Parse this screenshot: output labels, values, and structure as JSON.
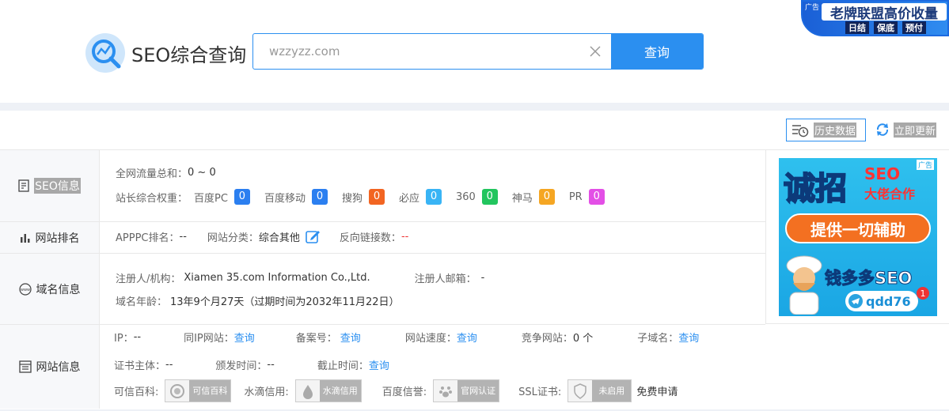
{
  "header": {
    "logo_title": "SEO综合查询",
    "search_value": "wzzyzz.com",
    "search_button": "查询"
  },
  "top_ad": {
    "tag": "广告",
    "title": "老牌联盟高价收量",
    "sub1": "日结",
    "sub2": "保底",
    "sub3": "预付"
  },
  "toolbar": {
    "history_label": "历史数据",
    "update_label": "立即更新"
  },
  "seo_info": {
    "label": "SEO信息",
    "traffic_key": "全网流量总和：",
    "traffic_value": "0 ~ 0",
    "weight_key": "站长综合权重：",
    "weights": [
      {
        "name": "百度PC",
        "value": "0",
        "color": "#2b7ff0"
      },
      {
        "name": "百度移动",
        "value": "0",
        "color": "#2b7ff0"
      },
      {
        "name": "搜狗",
        "value": "0",
        "color": "#f26522"
      },
      {
        "name": "必应",
        "value": "0",
        "color": "#39b4f5"
      },
      {
        "name": "360",
        "value": "0",
        "color": "#22c55e"
      },
      {
        "name": "神马",
        "value": "0",
        "color": "#f5a623"
      },
      {
        "name": "PR",
        "value": "0",
        "color": "#e34fe6"
      }
    ]
  },
  "rank_info": {
    "label": "网站排名",
    "apppc_key": "APPPC排名：",
    "apppc_value": "--",
    "category_key": "网站分类：",
    "category_value": "综合其他",
    "backlink_key": "反向链接数：",
    "backlink_value": "--"
  },
  "domain_info": {
    "label": "域名信息",
    "registrant_key": "注册人/机构：",
    "registrant_value": "Xiamen 35.com Information Co.,Ltd.",
    "email_key": "注册人邮箱：",
    "email_value": "-",
    "age_key": "域名年龄：",
    "age_value": "13年9个月27天（过期时间为2032年11月22日）"
  },
  "site_info": {
    "label": "网站信息",
    "ip_key": "IP：",
    "ip_value": "--",
    "same_ip_key": "同IP网站：",
    "same_ip_value": "查询",
    "icp_key": "备案号：",
    "icp_value": "查询",
    "speed_key": "网站速度：",
    "speed_value": "查询",
    "compete_key": "竞争网站：",
    "compete_value": "0 个",
    "subdomain_key": "子域名：",
    "subdomain_value": "查询",
    "cert_subject_key": "证书主体：",
    "cert_subject_value": "--",
    "issue_key": "颁发时间：",
    "issue_value": "--",
    "expire_key": "截止时间：",
    "expire_value": "查询",
    "baike_key": "可信百科:",
    "baike_badge": "可信百科",
    "shuidi_key": "水滴信用:",
    "shuidi_badge": "水滴信用",
    "baidu_key": "百度信誉:",
    "baidu_badge": "官网认证",
    "ssl_key": "SSL证书:",
    "ssl_badge": "未启用",
    "ssl_apply": "免费申请"
  },
  "side_ad": {
    "tag": "广告",
    "big": "诚招",
    "seo": "SEO",
    "partner": "大佬合作",
    "banner": "提供一切辅助",
    "brand": "钱多多SEO",
    "contact": "qdd76",
    "notify": "1"
  }
}
